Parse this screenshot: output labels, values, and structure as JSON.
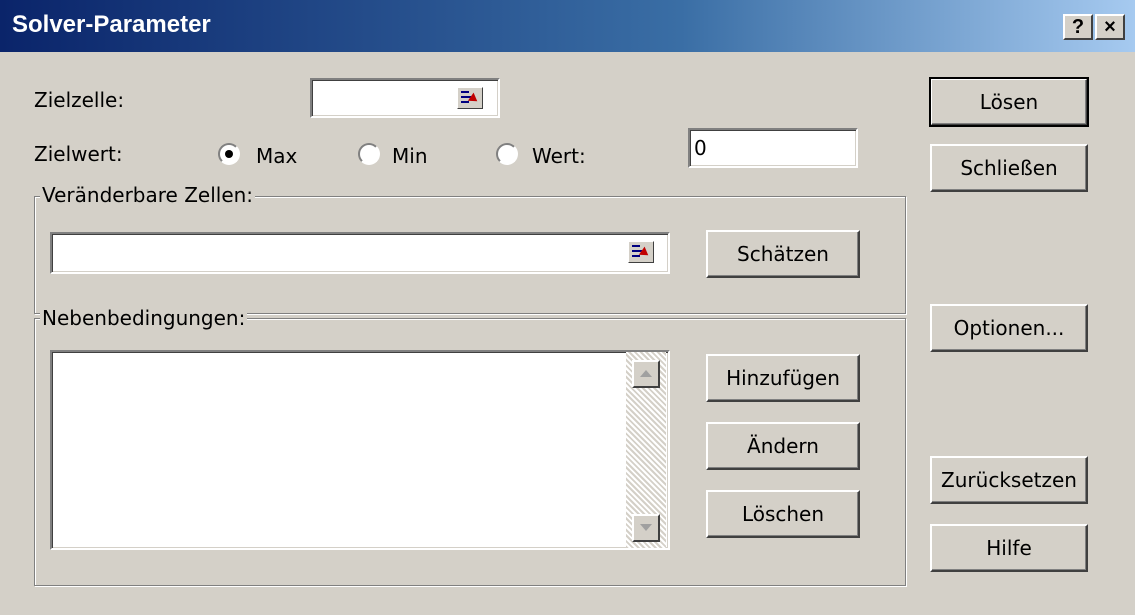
{
  "window": {
    "title": "Solver-Parameter",
    "help_label": "?",
    "close_label": "×"
  },
  "fields": {
    "target_cell_label": "Zielzelle:",
    "target_value_label": "Zielwert:",
    "target_cell_value": "",
    "value_input": "0"
  },
  "radios": {
    "max_label": "Max",
    "min_label": "Min",
    "value_label": "Wert:",
    "selected": "max"
  },
  "changeable": {
    "legend": "Veränderbare Zellen:",
    "input_value": "",
    "guess_label": "Schätzen"
  },
  "constraints": {
    "legend": "Nebenbedingungen:",
    "items": [],
    "add_label": "Hinzufügen",
    "change_label": "Ändern",
    "delete_label": "Löschen"
  },
  "side_buttons": {
    "solve_label": "Lösen",
    "close_label": "Schließen",
    "options_label": "Optionen...",
    "reset_label": "Zurücksetzen",
    "help_label": "Hilfe"
  },
  "icons": {
    "ref": "range-select-icon",
    "scroll_up": "scroll-up-arrow-icon",
    "scroll_down": "scroll-down-arrow-icon"
  }
}
